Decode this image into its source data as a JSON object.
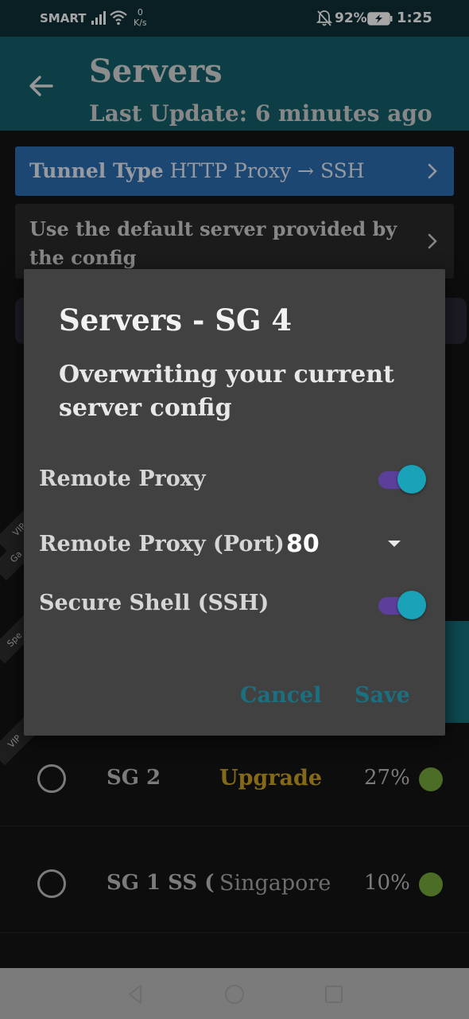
{
  "status_bar": {
    "carrier": "SMART",
    "speed_value": "0",
    "speed_unit": "K/s",
    "battery_percent": "92%",
    "time": "1:25"
  },
  "app_bar": {
    "title": "Servers",
    "subtitle": "Last Update: 6 minutes ago"
  },
  "settings": {
    "tunnel_label": "Tunnel Type",
    "tunnel_value": "HTTP Proxy → SSH",
    "default_server_text": "Use the default server provided by the config"
  },
  "ribbons": [
    "VIP",
    "Ga",
    "Spe",
    "VIP"
  ],
  "servers": [
    {
      "name": "SG 2",
      "tag": "Upgrade",
      "tag_color": "#c9a227",
      "load": "27%",
      "status_color": "#73a839"
    },
    {
      "name": "SG 1 SS (",
      "tag": "Singapore",
      "tag_color": "#a8a8a8",
      "load": "10%",
      "status_color": "#73a839"
    }
  ],
  "dialog": {
    "title": "Servers - SG 4",
    "message": "Overwriting your current server config",
    "remote_proxy_label": "Remote Proxy",
    "remote_proxy_enabled": true,
    "remote_proxy_port_label": "Remote Proxy (Port)",
    "remote_proxy_port_value": "80",
    "ssh_label": "Secure Shell (SSH)",
    "ssh_enabled": true,
    "cancel_label": "Cancel",
    "save_label": "Save"
  },
  "colors": {
    "app_bar": "#145f6b",
    "tunnel_row": "#2c6eb0",
    "dialog_bg": "#414141",
    "dialog_button": "#1a6f80",
    "switch_thumb": "#1aa2b8",
    "switch_track": "#5b3f9a"
  },
  "icons": {
    "back": "arrow-left-icon",
    "chevron": "chevron-right-icon",
    "dropdown": "caret-down-icon"
  }
}
